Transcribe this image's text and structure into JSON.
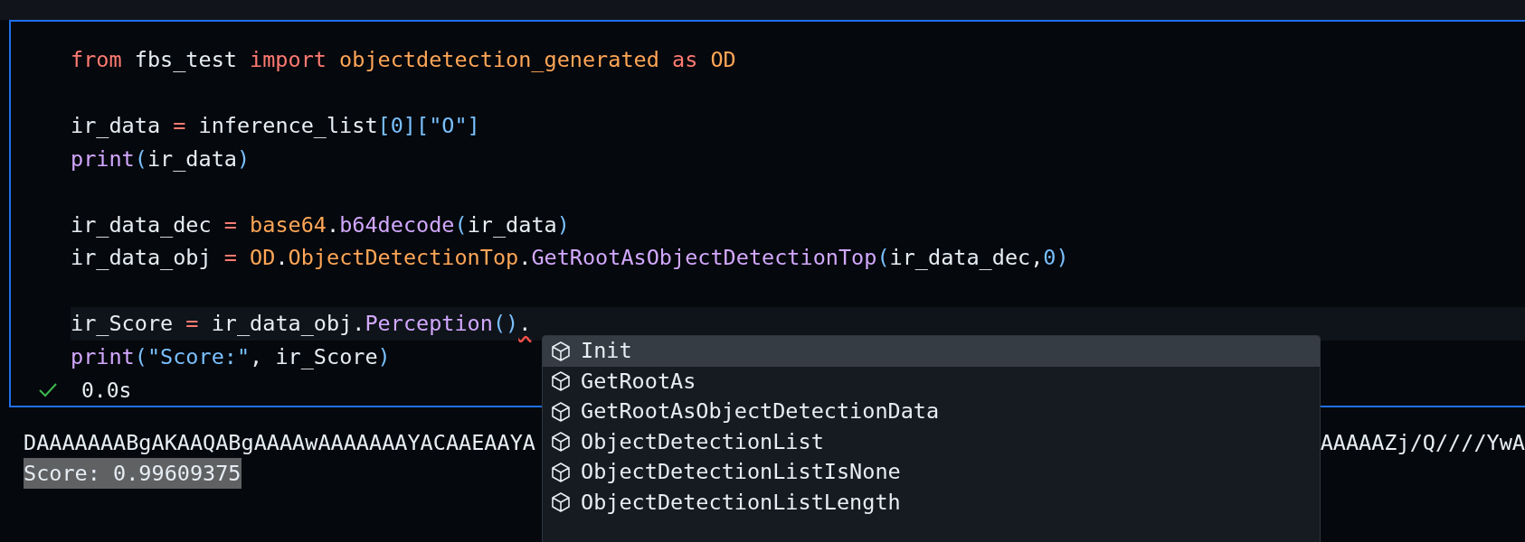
{
  "code_cell": {
    "lines": [
      {
        "kind": "code",
        "current": false,
        "tokens": [
          {
            "text": "from",
            "kind": "keyword"
          },
          {
            "text": " fbs_test ",
            "kind": "plain"
          },
          {
            "text": "import",
            "kind": "keyword"
          },
          {
            "text": " objectdetection_generated ",
            "kind": "module"
          },
          {
            "text": "as",
            "kind": "keyword"
          },
          {
            "text": " OD",
            "kind": "module"
          }
        ]
      },
      {
        "kind": "blank"
      },
      {
        "kind": "code",
        "current": false,
        "tokens": [
          {
            "text": "ir_data ",
            "kind": "plain"
          },
          {
            "text": "=",
            "kind": "keyword"
          },
          {
            "text": " inference_list",
            "kind": "plain"
          },
          {
            "text": "[0][\"O\"]",
            "kind": "literal"
          }
        ]
      },
      {
        "kind": "code",
        "current": false,
        "tokens": [
          {
            "text": "print",
            "kind": "func"
          },
          {
            "text": "(",
            "kind": "literal"
          },
          {
            "text": "ir_data",
            "kind": "plain"
          },
          {
            "text": ")",
            "kind": "literal"
          }
        ]
      },
      {
        "kind": "blank"
      },
      {
        "kind": "code",
        "current": false,
        "tokens": [
          {
            "text": "ir_data_dec ",
            "kind": "plain"
          },
          {
            "text": "=",
            "kind": "keyword"
          },
          {
            "text": " base64",
            "kind": "module"
          },
          {
            "text": ".",
            "kind": "plain"
          },
          {
            "text": "b64decode",
            "kind": "func"
          },
          {
            "text": "(",
            "kind": "literal"
          },
          {
            "text": "ir_data",
            "kind": "plain"
          },
          {
            "text": ")",
            "kind": "literal"
          }
        ]
      },
      {
        "kind": "code",
        "current": false,
        "tokens": [
          {
            "text": "ir_data_obj ",
            "kind": "plain"
          },
          {
            "text": "=",
            "kind": "keyword"
          },
          {
            "text": " OD",
            "kind": "module"
          },
          {
            "text": ".",
            "kind": "plain"
          },
          {
            "text": "ObjectDetectionTop",
            "kind": "module"
          },
          {
            "text": ".",
            "kind": "plain"
          },
          {
            "text": "GetRootAsObjectDetectionTop",
            "kind": "func"
          },
          {
            "text": "(",
            "kind": "literal"
          },
          {
            "text": "ir_data_dec,",
            "kind": "plain"
          },
          {
            "text": "0)",
            "kind": "literal"
          }
        ]
      },
      {
        "kind": "blank"
      },
      {
        "kind": "code",
        "current": true,
        "tokens": [
          {
            "text": "ir_Score ",
            "kind": "plain"
          },
          {
            "text": "=",
            "kind": "keyword"
          },
          {
            "text": " ir_data_obj.",
            "kind": "plain"
          },
          {
            "text": "Perception",
            "kind": "func"
          },
          {
            "text": "()",
            "kind": "literal"
          },
          {
            "text": ".",
            "kind": "error"
          }
        ]
      },
      {
        "kind": "code",
        "current": false,
        "tokens": [
          {
            "text": "print",
            "kind": "func"
          },
          {
            "text": "(\"Score:\"",
            "kind": "literal"
          },
          {
            "text": ", ir_Score",
            "kind": "plain"
          },
          {
            "text": ")",
            "kind": "literal"
          }
        ]
      }
    ],
    "status": {
      "succeeded": true,
      "duration": "0.0s"
    }
  },
  "output": {
    "lines": [
      {
        "text": "DAAAAAAABgAKAAQABgAAAAwAAAAAAAYACAAEAAYA",
        "text_right": "AAAAAZj/Q////YwA",
        "selected": false
      },
      {
        "text": "Score: 0.99609375",
        "selected": true
      }
    ]
  },
  "suggestions": [
    {
      "label": "Init",
      "selected": true
    },
    {
      "label": "GetRootAs",
      "selected": false
    },
    {
      "label": "GetRootAsObjectDetectionData",
      "selected": false
    },
    {
      "label": "ObjectDetectionList",
      "selected": false
    },
    {
      "label": "ObjectDetectionListIsNone",
      "selected": false
    },
    {
      "label": "ObjectDetectionListLength",
      "selected": false
    }
  ]
}
